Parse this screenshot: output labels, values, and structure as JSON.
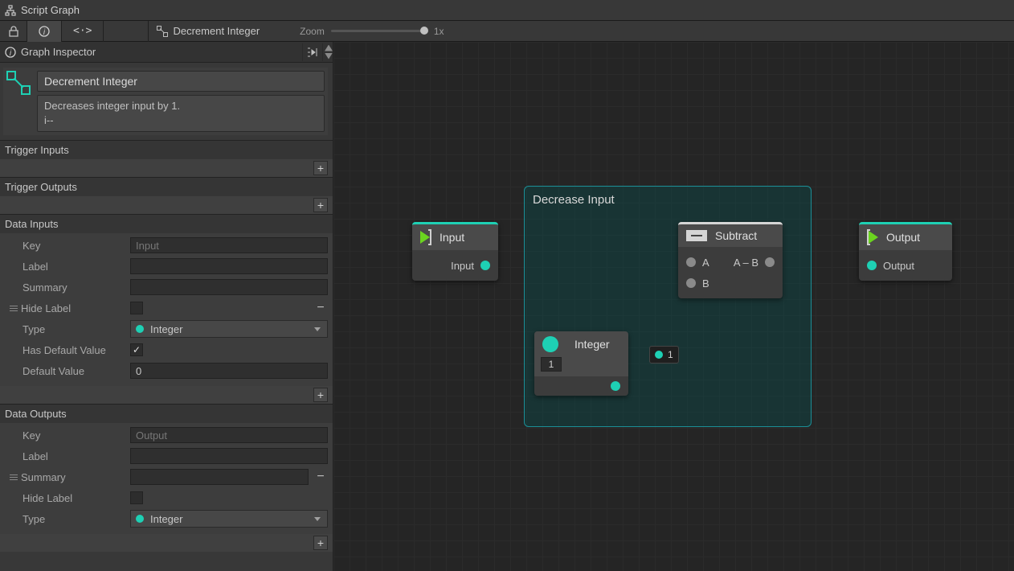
{
  "window": {
    "title": "Script Graph"
  },
  "toolbar": {
    "crumb_label": "Decrement Integer",
    "zoom_label": "Zoom",
    "zoom_value": "1x"
  },
  "inspector": {
    "title": "Graph Inspector",
    "node_name": "Decrement Integer",
    "node_summary": "Decreases integer input by 1.\ni--",
    "sections": {
      "trigger_inputs": "Trigger Inputs",
      "trigger_outputs": "Trigger Outputs",
      "data_inputs": "Data Inputs",
      "data_outputs": "Data Outputs"
    },
    "labels": {
      "key": "Key",
      "label": "Label",
      "summary": "Summary",
      "hide_label": "Hide Label",
      "type": "Type",
      "has_default": "Has Default Value",
      "default_value": "Default Value"
    },
    "data_input": {
      "key_placeholder": "Input",
      "label_value": "",
      "summary_value": "",
      "hide_label": false,
      "type": "Integer",
      "has_default": true,
      "default_value": "0"
    },
    "data_output": {
      "key_placeholder": "Output",
      "label_value": "",
      "summary_value": "",
      "hide_label": false,
      "type": "Integer"
    }
  },
  "canvas": {
    "group_title": "Decrease Input",
    "nodes": {
      "input": {
        "title": "Input",
        "port_out": "Input"
      },
      "subtract": {
        "title": "Subtract",
        "port_a": "A",
        "port_result": "A – B",
        "port_b": "B"
      },
      "output": {
        "title": "Output",
        "port_in": "Output"
      },
      "integer": {
        "title": "Integer",
        "value": "1"
      }
    },
    "tooltip_value": "1"
  }
}
